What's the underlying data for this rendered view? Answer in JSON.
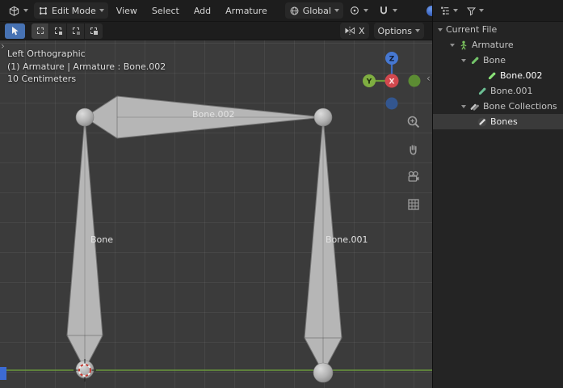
{
  "topbar": {
    "mode_label": "Edit Mode",
    "menus": [
      "View",
      "Select",
      "Add",
      "Armature"
    ],
    "orientation_label": "Global"
  },
  "toolbar": {
    "mirror_x_label": "X",
    "options_label": "Options"
  },
  "viewport": {
    "overlay": {
      "view_name": "Left Orthographic",
      "context": "(1) Armature | Armature : Bone.002",
      "scale": "10 Centimeters"
    },
    "gizmo": {
      "x": "X",
      "y": "Y",
      "z": "Z"
    },
    "bones": [
      {
        "label": "Bone"
      },
      {
        "label": "Bone.001"
      },
      {
        "label": "Bone.002"
      }
    ]
  },
  "outliner": {
    "items": [
      {
        "label": "Current File"
      },
      {
        "label": "Armature"
      },
      {
        "label": "Bone"
      },
      {
        "label": "Bone.002"
      },
      {
        "label": "Bone.001"
      },
      {
        "label": "Bone Collections"
      },
      {
        "label": "Bones"
      }
    ]
  },
  "colors": {
    "selection_accent": "#4772b3",
    "axis_x": "#cb4449",
    "axis_y": "#71a33c",
    "axis_z": "#3b6fc9",
    "axis_y_line": "#6d9e3c",
    "bone_fill": "#b6b6b6",
    "viewport_bg": "#3b3b3b",
    "outliner_bone_icon": "#74c46a"
  }
}
